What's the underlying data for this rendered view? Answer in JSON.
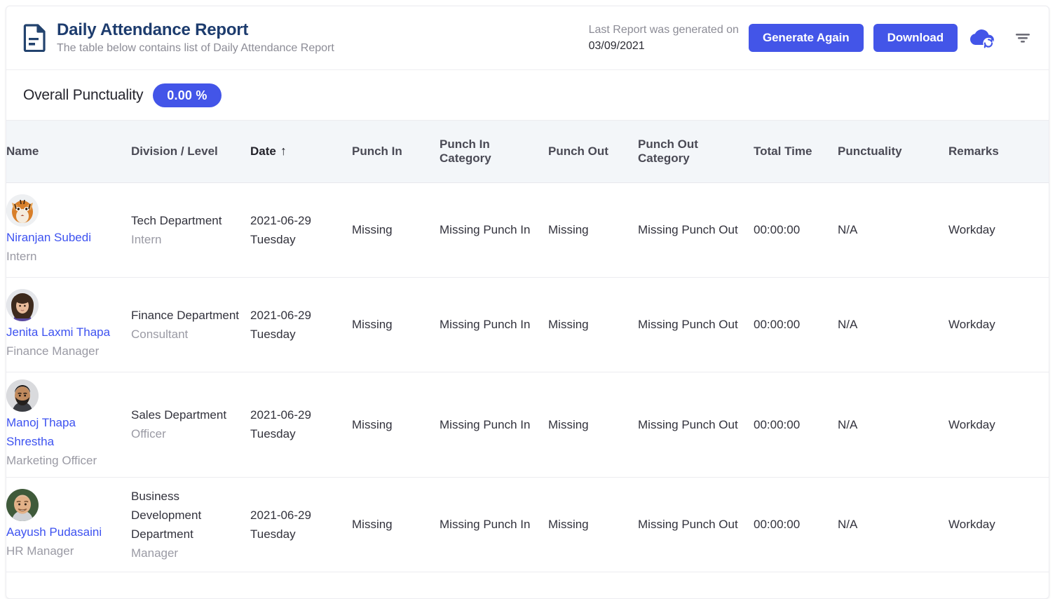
{
  "header": {
    "icon": "document-icon",
    "title": "Daily Attendance Report",
    "subtitle": "The table below contains list of Daily Attendance Report",
    "last_report_text": "Last Report was generated on",
    "last_report_date": "03/09/2021",
    "generate_button": "Generate Again",
    "download_button": "Download",
    "cloud_sync_icon": "cloud-sync-icon",
    "filter_icon": "filter-icon",
    "accent_color": "#4355e8",
    "title_color": "#1d3c6e"
  },
  "summary": {
    "label": "Overall Punctuality",
    "value": "0.00 %",
    "badge_color": "#4355e8"
  },
  "table": {
    "columns": [
      "Name",
      "Division / Level",
      "Date",
      "Punch In",
      "Punch In Category",
      "Punch Out",
      "Punch Out Category",
      "Total Time",
      "Punctuality",
      "Remarks"
    ],
    "sorted_column": "Date",
    "sort_direction": "↑",
    "rows": [
      {
        "avatar": "tiger-avatar",
        "name": "Niranjan Subedi",
        "role": "Intern",
        "division": "Tech Department",
        "level": "Intern",
        "date": "2021-06-29",
        "day": "Tuesday",
        "punch_in": "Missing",
        "punch_in_category": "Missing Punch In",
        "punch_out": "Missing",
        "punch_out_category": "Missing Punch Out",
        "total_time": "00:00:00",
        "punctuality": "N/A",
        "remarks": "Workday"
      },
      {
        "avatar": "woman-avatar",
        "name": "Jenita Laxmi Thapa",
        "role": "Finance Manager",
        "division": "Finance Department",
        "level": "Consultant",
        "date": "2021-06-29",
        "day": "Tuesday",
        "punch_in": "Missing",
        "punch_in_category": "Missing Punch In",
        "punch_out": "Missing",
        "punch_out_category": "Missing Punch Out",
        "total_time": "00:00:00",
        "punctuality": "N/A",
        "remarks": "Workday"
      },
      {
        "avatar": "man-beard-avatar",
        "name": "Manoj Thapa Shrestha",
        "role": "Marketing Officer",
        "division": "Sales Department",
        "level": "Officer",
        "date": "2021-06-29",
        "day": "Tuesday",
        "punch_in": "Missing",
        "punch_in_category": "Missing Punch In",
        "punch_out": "Missing",
        "punch_out_category": "Missing Punch Out",
        "total_time": "00:00:00",
        "punctuality": "N/A",
        "remarks": "Workday"
      },
      {
        "avatar": "man-smiling-avatar",
        "name": "Aayush Pudasaini",
        "role": "HR Manager",
        "division": "Business Development Department",
        "level": "Manager",
        "date": "2021-06-29",
        "day": "Tuesday",
        "punch_in": "Missing",
        "punch_in_category": "Missing Punch In",
        "punch_out": "Missing",
        "punch_out_category": "Missing Punch Out",
        "total_time": "00:00:00",
        "punctuality": "N/A",
        "remarks": "Workday"
      }
    ]
  }
}
